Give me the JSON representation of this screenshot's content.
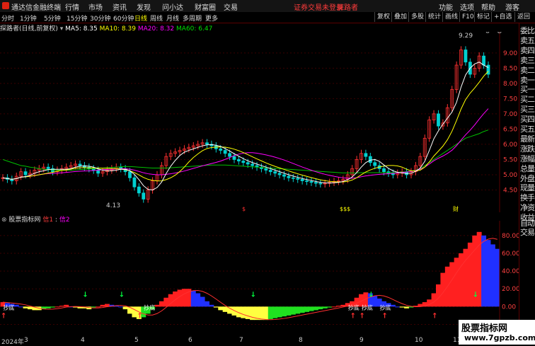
{
  "app": {
    "title": "通达信金融终端",
    "menu": [
      "行情",
      "市场",
      "资讯",
      "发现",
      "问小达",
      "财富圈",
      "交易"
    ],
    "warning": "证券交易未登录",
    "user_title": "探路者",
    "right_menu": [
      "功能",
      "选项",
      "帮助",
      "游客"
    ],
    "window_controls": [
      "-",
      "□",
      "×"
    ]
  },
  "period_tabs": [
    "分时",
    "1分钟",
    "5分钟",
    "15分钟",
    "30分钟",
    "60分钟",
    "日线",
    "周线",
    "月线",
    "多周期",
    "更多"
  ],
  "active_period": "日线",
  "right_buttons": [
    "复权",
    "叠加",
    "多股",
    "统计",
    "画线",
    "F10",
    "标记",
    "+自选",
    "返回"
  ],
  "info": {
    "name": "探路者(日线,前复权)",
    "ma5": "MA5: 8.35",
    "ma10": "MA10: 8.39",
    "ma20": "MA20: 8.32",
    "ma60": "MA60: 6.47",
    "colors": {
      "ma5": "#ffffff",
      "ma10": "#ffff00",
      "ma20": "#ff00ff",
      "ma60": "#00e000"
    }
  },
  "price_axis": [
    "9.00",
    "8.50",
    "8.00",
    "7.50",
    "7.00",
    "6.50",
    "6.00",
    "5.50",
    "5.00",
    "4.50"
  ],
  "marks": {
    "high": "9.29",
    "low": "4.13",
    "event1": "$",
    "event2": "$$$",
    "event3": "财"
  },
  "indicator": {
    "name": "股票指标网",
    "items": [
      "信1",
      "信2"
    ],
    "axis": [
      "80.00",
      "60.00",
      "40.00",
      "20.00",
      "0.00",
      "-20.00"
    ],
    "signal_text": "抄底"
  },
  "dates": [
    "2024年",
    "3",
    "4",
    "5",
    "6",
    "7",
    "8",
    "9",
    "10",
    "11"
  ],
  "sidebar": [
    "委比",
    "卖五",
    "卖四",
    "卖三",
    "卖二",
    "卖一",
    "买一",
    "买二",
    "买三",
    "买四",
    "买五",
    "最新",
    "涨跌",
    "涨幅",
    "总量",
    "外盘",
    "现量",
    "换手",
    "净资",
    "收益",
    "自动",
    "交易"
  ],
  "watermark": {
    "line1": "股票指标网",
    "line2": "www.7gpzb.com"
  },
  "chart_data": {
    "type": "line",
    "price_range": [
      4.0,
      9.6
    ],
    "indicator_range": [
      -30,
      95
    ],
    "close": [
      4.9,
      4.85,
      4.8,
      4.95,
      5.1,
      5.0,
      5.05,
      5.15,
      5.2,
      5.25,
      5.2,
      5.1,
      5.15,
      5.2,
      5.25,
      5.3,
      5.35,
      5.3,
      5.25,
      5.2,
      5.15,
      5.05,
      5.1,
      5.15,
      5.2,
      5.25,
      5.2,
      5.1,
      4.9,
      4.6,
      4.4,
      4.2,
      4.5,
      4.8,
      5.0,
      5.3,
      5.6,
      5.7,
      5.75,
      5.8,
      5.85,
      5.9,
      5.95,
      6.0,
      6.05,
      6.0,
      5.95,
      5.85,
      5.8,
      5.7,
      5.6,
      5.5,
      5.45,
      5.4,
      5.35,
      5.3,
      5.25,
      5.2,
      5.15,
      5.1,
      5.05,
      5.0,
      4.95,
      4.9,
      4.88,
      4.85,
      4.8,
      4.78,
      4.75,
      4.72,
      4.7,
      4.72,
      4.75,
      4.78,
      4.8,
      4.85,
      5.0,
      5.2,
      5.5,
      5.7,
      5.6,
      5.4,
      5.3,
      5.2,
      5.1,
      5.05,
      5.0,
      5.05,
      5.1,
      5.0,
      5.1,
      5.3,
      5.6,
      6.2,
      6.8,
      7.0,
      6.6,
      6.7,
      7.2,
      7.8,
      8.6,
      9.1,
      8.7,
      8.3,
      8.5,
      8.9,
      8.6,
      8.3
    ],
    "ma60": [
      5.5,
      5.45,
      5.4,
      5.35,
      5.3,
      5.28,
      5.25,
      5.23,
      5.2,
      5.18,
      5.17,
      5.16,
      5.15,
      5.15,
      5.15,
      5.15,
      5.16,
      5.17,
      5.18,
      5.19,
      5.2,
      5.21,
      5.22,
      5.23,
      5.24,
      5.25,
      5.26,
      5.27,
      5.27,
      5.26,
      5.25,
      5.24,
      5.23,
      5.22,
      5.22,
      5.22,
      5.22,
      5.23,
      5.24,
      5.25,
      5.26,
      5.27,
      5.28,
      5.29,
      5.3,
      5.31,
      5.32,
      5.32,
      5.32,
      5.32,
      5.31,
      5.3,
      5.29,
      5.28,
      5.27,
      5.26,
      5.25,
      5.24,
      5.23,
      5.22,
      5.21,
      5.2,
      5.19,
      5.18,
      5.17,
      5.16,
      5.15,
      5.14,
      5.13,
      5.12,
      5.11,
      5.1,
      5.09,
      5.08,
      5.07,
      5.06,
      5.06,
      5.06,
      5.06,
      5.07,
      5.07,
      5.07,
      5.07,
      5.07,
      5.07,
      5.07,
      5.07,
      5.08,
      5.09,
      5.1,
      5.12,
      5.15,
      5.2,
      5.3,
      5.4,
      5.5,
      5.6,
      5.7,
      5.8,
      5.9,
      6.0,
      6.1,
      6.2,
      6.25,
      6.3,
      6.35,
      6.42,
      6.47
    ],
    "indicator": [
      5,
      4,
      3,
      2,
      0,
      -2,
      -3,
      -4,
      -4,
      -3,
      -2,
      -1,
      0,
      1,
      2,
      0,
      -1,
      -2,
      -2,
      -3,
      -1,
      0,
      2,
      3,
      2,
      1,
      0,
      -3,
      -8,
      -12,
      -14,
      -12,
      -8,
      -3,
      2,
      6,
      10,
      14,
      17,
      19,
      20,
      20,
      18,
      15,
      11,
      6,
      2,
      -1,
      -4,
      -6,
      -8,
      -10,
      -12,
      -13,
      -14,
      -15,
      -15,
      -15,
      -15,
      -14,
      -13,
      -12,
      -11,
      -10,
      -9,
      -8,
      -7,
      -6,
      -5,
      -4,
      -3,
      -2,
      -1,
      0,
      1,
      2,
      4,
      6,
      10,
      14,
      16,
      15,
      12,
      9,
      6,
      4,
      2,
      0,
      -1,
      -2,
      -1,
      1,
      3,
      5,
      8,
      15,
      25,
      38,
      45,
      50,
      55,
      60,
      65,
      72,
      80,
      84,
      80,
      75,
      70,
      65
    ]
  }
}
